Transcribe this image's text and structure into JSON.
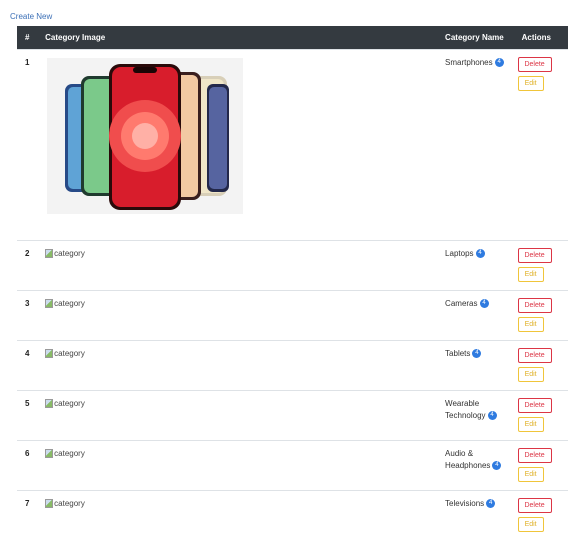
{
  "create_link": "Create New",
  "table": {
    "headers": [
      "#",
      "Category Image",
      "Category Name",
      "Actions"
    ],
    "broken_image_alt": "category",
    "delete_label": "Delete",
    "edit_label": "Edit",
    "rows": [
      {
        "num": "1",
        "name": "Smartphones",
        "badge": "4",
        "has_image": true
      },
      {
        "num": "2",
        "name": "Laptops",
        "badge": "4",
        "has_image": false
      },
      {
        "num": "3",
        "name": "Cameras",
        "badge": "4",
        "has_image": false
      },
      {
        "num": "4",
        "name": "Tablets",
        "badge": "4",
        "has_image": false
      },
      {
        "num": "5",
        "name": "Wearable Technology",
        "badge": "4",
        "has_image": false
      },
      {
        "num": "6",
        "name": "Audio & Headphones",
        "badge": "4",
        "has_image": false
      },
      {
        "num": "7",
        "name": "Televisions",
        "badge": "4",
        "has_image": false
      }
    ]
  },
  "colors": {
    "header_bg": "#343a40",
    "badge": "#2f7be0",
    "delete": "#dc3545",
    "edit": "#f0c53a",
    "link": "#3b6fb6"
  }
}
